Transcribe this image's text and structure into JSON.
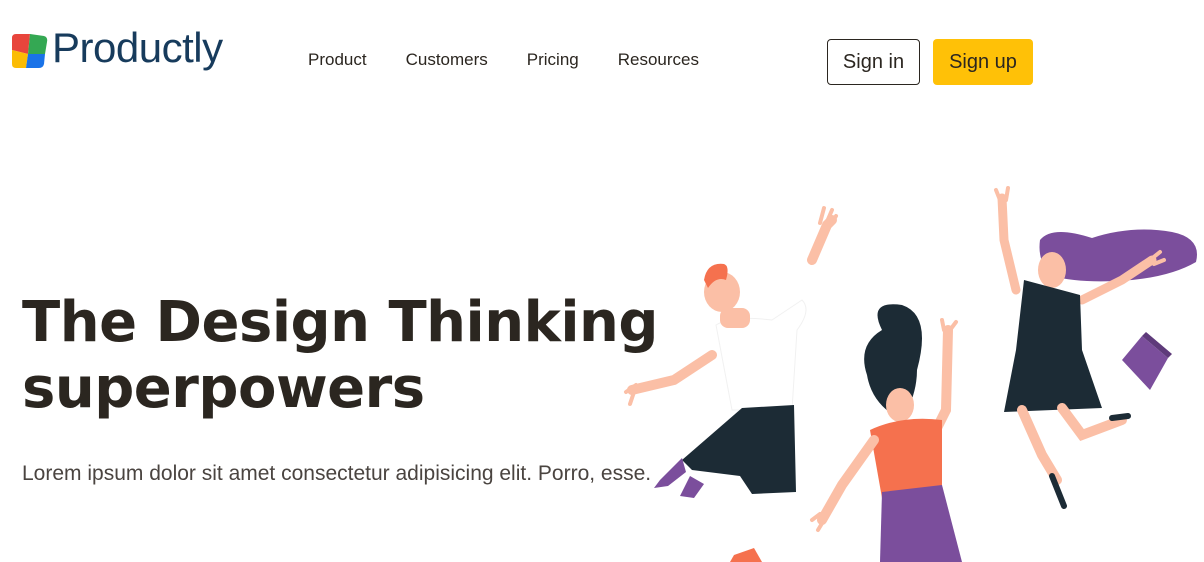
{
  "brand": {
    "name": "Productly"
  },
  "nav": {
    "items": [
      "Product",
      "Customers",
      "Pricing",
      "Resources"
    ]
  },
  "auth": {
    "signin_label": "Sign in",
    "signup_label": "Sign up"
  },
  "hero": {
    "title_line1": "The Design Thinking",
    "title_line2": "superpowers",
    "subtitle": "Lorem ipsum dolor sit amet consectetur adipisicing elit. Porro, esse."
  },
  "colors": {
    "accent": "#ffc107",
    "brand_text": "#173b5c",
    "text": "#2b2620",
    "logo_red": "#e8453c",
    "logo_green": "#34a853",
    "logo_yellow": "#fbbc05",
    "logo_blue": "#1a73e8"
  },
  "icons": {
    "logo": "productly-logo-icon",
    "illustration": "jumping-people-illustration"
  }
}
